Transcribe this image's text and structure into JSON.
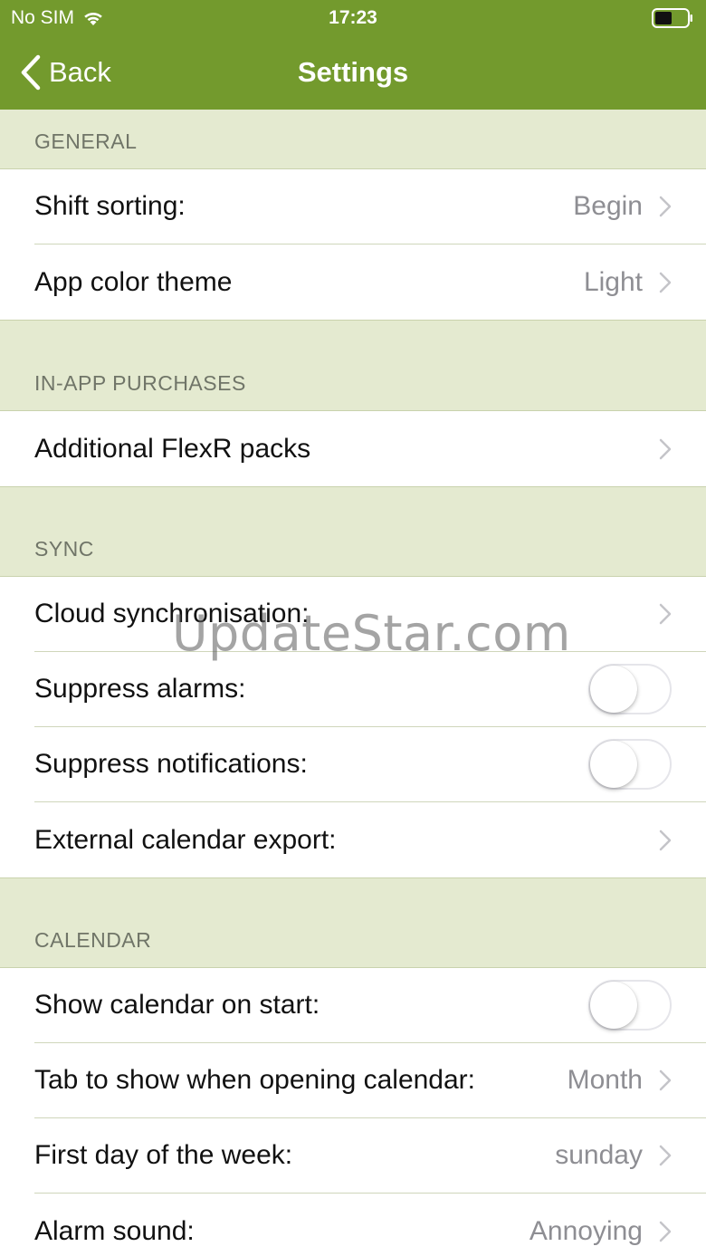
{
  "status_bar": {
    "carrier": "No SIM",
    "time": "17:23"
  },
  "nav": {
    "back_label": "Back",
    "title": "Settings"
  },
  "colors": {
    "nav_bg": "#739a2d",
    "section_bg": "#e4ead0",
    "value_gray": "#8e8e93"
  },
  "sections": {
    "general": {
      "header": "GENERAL",
      "rows": [
        {
          "label": "Shift sorting:",
          "value": "Begin"
        },
        {
          "label": "App color theme",
          "value": "Light"
        }
      ]
    },
    "purchases": {
      "header": "IN-APP PURCHASES",
      "rows": [
        {
          "label": "Additional FlexR packs"
        }
      ]
    },
    "sync": {
      "header": "SYNC",
      "rows": [
        {
          "label": "Cloud synchronisation:"
        },
        {
          "label": "Suppress alarms:",
          "toggle": false
        },
        {
          "label": "Suppress notifications:",
          "toggle": false
        },
        {
          "label": "External calendar export:"
        }
      ]
    },
    "calendar": {
      "header": "CALENDAR",
      "rows": [
        {
          "label": "Show calendar on start:",
          "toggle": false
        },
        {
          "label": "Tab to show when opening calendar:",
          "value": "Month"
        },
        {
          "label": "First day of the week:",
          "value": "sunday"
        },
        {
          "label": "Alarm sound:",
          "value": "Annoying"
        }
      ]
    }
  },
  "watermark": "UpdateStar.com"
}
